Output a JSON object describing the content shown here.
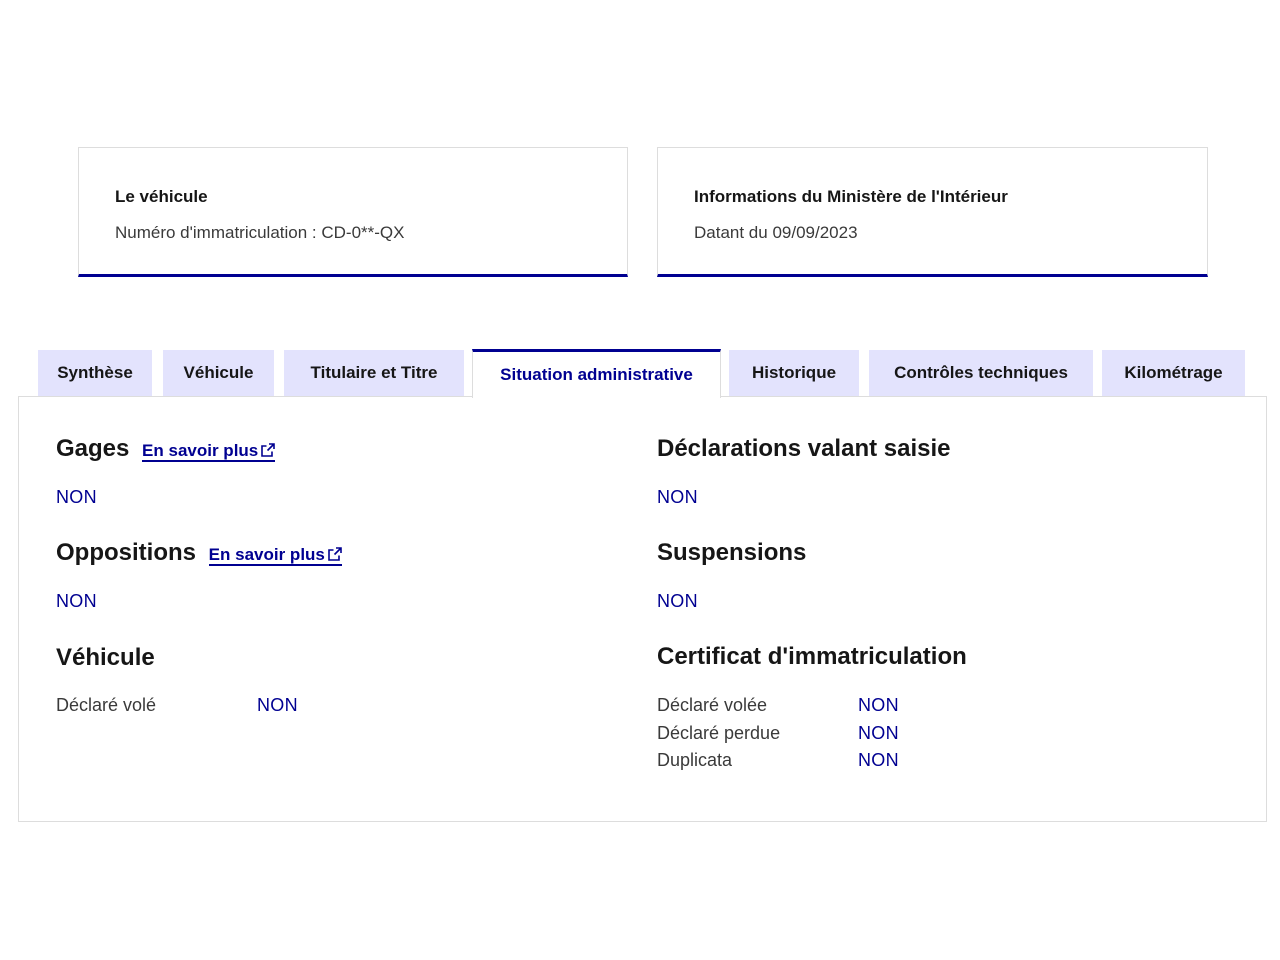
{
  "vehicle_card": {
    "title": "Le véhicule",
    "text": "Numéro d'immatriculation : CD-0**-QX"
  },
  "ministry_card": {
    "title": "Informations du Ministère de l'Intérieur",
    "text": "Datant du 09/09/2023"
  },
  "tabs": [
    {
      "label": "Synthèse"
    },
    {
      "label": "Véhicule"
    },
    {
      "label": "Titulaire et Titre"
    },
    {
      "label": "Situation administrative",
      "active": true
    },
    {
      "label": "Historique"
    },
    {
      "label": "Contrôles techniques"
    },
    {
      "label": "Kilométrage"
    }
  ],
  "sections": {
    "gages": {
      "title": "Gages",
      "link": "En savoir plus",
      "value": "NON"
    },
    "oppositions": {
      "title": "Oppositions",
      "link": "En savoir plus",
      "value": "NON"
    },
    "vehicule": {
      "title": "Véhicule",
      "rows": [
        {
          "label": "Déclaré volé",
          "value": "NON"
        }
      ]
    },
    "declarations": {
      "title": "Déclarations valant saisie",
      "value": "NON"
    },
    "suspensions": {
      "title": "Suspensions",
      "value": "NON"
    },
    "certificat": {
      "title": "Certificat d'immatriculation",
      "rows": [
        {
          "label": "Déclaré volée",
          "value": "NON"
        },
        {
          "label": "Déclaré perdue",
          "value": "NON"
        },
        {
          "label": "Duplicata",
          "value": "NON"
        }
      ]
    }
  },
  "colors": {
    "accent": "#000091",
    "tab_background": "#e3e3fd"
  },
  "icons": {
    "external_link": "external-link-icon"
  }
}
